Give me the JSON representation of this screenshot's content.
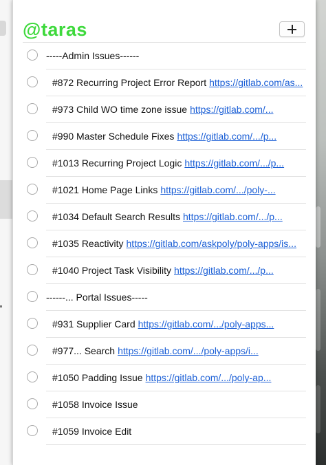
{
  "header": {
    "title": "@taras",
    "add_icon": "plus-icon"
  },
  "items": [
    {
      "type": "section",
      "label": "-----Admin Issues------"
    },
    {
      "type": "task",
      "label": "#872 Recurring Project Error Report",
      "link": "https://gitlab.com/as..."
    },
    {
      "type": "task",
      "label": "#973 Child WO time zone issue",
      "link": "https://gitlab.com/..."
    },
    {
      "type": "task",
      "label": "#990 Master Schedule Fixes",
      "link": "https://gitlab.com/.../p..."
    },
    {
      "type": "task",
      "label": "#1013 Recurring Project Logic",
      "link": "https://gitlab.com/.../p..."
    },
    {
      "type": "task",
      "label": "#1021 Home Page Links",
      "link": "https://gitlab.com/.../poly-..."
    },
    {
      "type": "task",
      "label": "#1034 Default Search Results",
      "link": "https://gitlab.com/.../p..."
    },
    {
      "type": "task",
      "label": "#1035 Reactivity",
      "link": "https://gitlab.com/askpoly/poly-apps/is..."
    },
    {
      "type": "task",
      "label": "#1040 Project Task Visibility",
      "link": "https://gitlab.com/.../p..."
    },
    {
      "type": "section",
      "label": "------... Portal Issues-----"
    },
    {
      "type": "task",
      "label": "#931 Supplier Card",
      "link": "https://gitlab.com/.../poly-apps..."
    },
    {
      "type": "task",
      "label": "#977... Search",
      "link": "https://gitlab.com/.../poly-apps/i..."
    },
    {
      "type": "task",
      "label": "#1050 Padding Issue",
      "link": "https://gitlab.com/.../poly-ap..."
    },
    {
      "type": "task",
      "label": "#1058 Invoice Issue",
      "link": ""
    },
    {
      "type": "task",
      "label": "#1059 Invoice Edit",
      "link": ""
    }
  ],
  "colors": {
    "title": "#3ed93c",
    "link": "#1b5fd6"
  }
}
